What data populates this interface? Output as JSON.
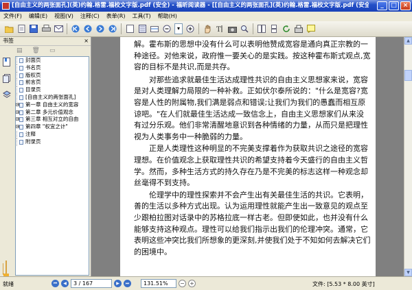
{
  "window": {
    "title": "[自由主义的两张面孔](英)约翰.格雷.福校文字版.pdf (安全) - 福昕阅读器 - [[自由主义的两张面孔](英)约翰.格雷.福校文字版.pdf (安全)]",
    "minimize": "_",
    "maximize": "□",
    "close": "×"
  },
  "menu": [
    "文件(F)",
    "编辑(E)",
    "视图(V)",
    "注释(C)",
    "表单(R)",
    "工具(T)",
    "帮助(H)"
  ],
  "toolbar": {
    "zoom_combo": "▾"
  },
  "sidebar": {
    "header": "书签",
    "close": "×",
    "bookmarks": [
      {
        "label": "封面页",
        "expandable": false
      },
      {
        "label": "书名页",
        "expandable": false
      },
      {
        "label": "版权页",
        "expandable": false
      },
      {
        "label": "前言页",
        "expandable": false
      },
      {
        "label": "目录页",
        "expandable": false
      },
      {
        "label": "[自由主义的两张面孔]",
        "expandable": false
      },
      {
        "label": "第一章 自由主义的宽容",
        "expandable": true
      },
      {
        "label": "第二章 多元价值观念",
        "expandable": true
      },
      {
        "label": "第三章 相互对立的自由",
        "expandable": true
      },
      {
        "label": "第四章 \"权宜之计\"",
        "expandable": true
      },
      {
        "label": "注释",
        "expandable": false
      },
      {
        "label": "附录页",
        "expandable": false
      }
    ]
  },
  "document": {
    "paragraphs": [
      "解。霍布斯的思想中没有什么可以表明他赞成宽容是通向真正宗教的一种途径。对他来说，政府惟一要关心的是实践。按这种霍布斯式观点,宽容的目标不是共识,而是共存。",
      "对那些追求就最佳生活达成理性共识的自由主义思想家来说，宽容是对人类理解力局限的一种补救。正如伏尔泰所说的：\"什么是宽容?宽容是人性的附属物,我们满是弱点和错误;让我们为我们的愚蠢而相互原谅吧。\"在人们就最佳生活达成一致信念上，自由主义思想家们从来没有过分乐观。他们非常清醒地意识到各种情绪的力量，从而只是把理性视为人类事务中一种脆弱的力量。",
      "正是人类理性这种明显的不完美支撑着作为获取共识之途径的宽容理想。在价值观念上获取理性共识的希望支持着今天盛行的自由主义哲学。然而，多种生活方式的持久存在乃是不完美的标志这样一种观念却丝毫得不到支持。",
      "伦理学中的理性探索并不会产生出有关最佳生活的共识。它表明，善的生活以多种方式出现。认为运用理性就能产生出一致意见的观点至少跟柏拉图对话录中的苏格拉底一样古老。但即使如此，也并没有什么能够支持这种观点。理性可以给我们指示出我们的伦理冲突。通常，它表明这些冲突比我们所想象的更深刻,并使我们处于不知如何去解决它们的困境中。"
    ]
  },
  "status": {
    "ready": "就绪",
    "page_indicator": "3 / 167",
    "zoom": "131.51%",
    "doc_size": "文件: [5.53 * 8.00 英寸]"
  }
}
